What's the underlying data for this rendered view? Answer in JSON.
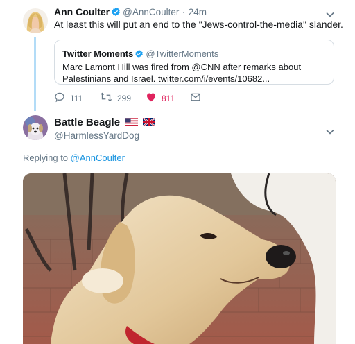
{
  "tweet1": {
    "name": "Ann Coulter",
    "handle": "@AnnCoulter",
    "separator": "·",
    "time": "24m",
    "text": "At least this will put an end to the \"Jews-control-the-media\" slander.",
    "quote": {
      "name": "Twitter Moments",
      "handle": "@TwitterMoments",
      "text": "Marc Lamont Hill was fired from @CNN after remarks about Palestinians and Israel. twitter.com/i/events/10682..."
    },
    "actions": {
      "replies": "111",
      "retweets": "299",
      "likes": "811"
    }
  },
  "tweet2": {
    "name": "Battle Beagle",
    "handle": "@HarmlessYardDog",
    "replying_prefix": "Replying to",
    "replying_handle": "@AnnCoulter"
  },
  "colors": {
    "link": "#1b95e0",
    "verified": "#1da1f2",
    "like": "#e0245e",
    "secondary_text": "#657786",
    "thread_line": "#b3dcf7"
  },
  "icons": {
    "reply": "reply-icon",
    "retweet": "retweet-icon",
    "like": "heart-icon",
    "dm": "envelope-icon",
    "verified": "verified-badge-icon",
    "caret": "chevron-down-icon",
    "flags": [
      "us-flag-icon",
      "uk-flag-icon"
    ]
  }
}
